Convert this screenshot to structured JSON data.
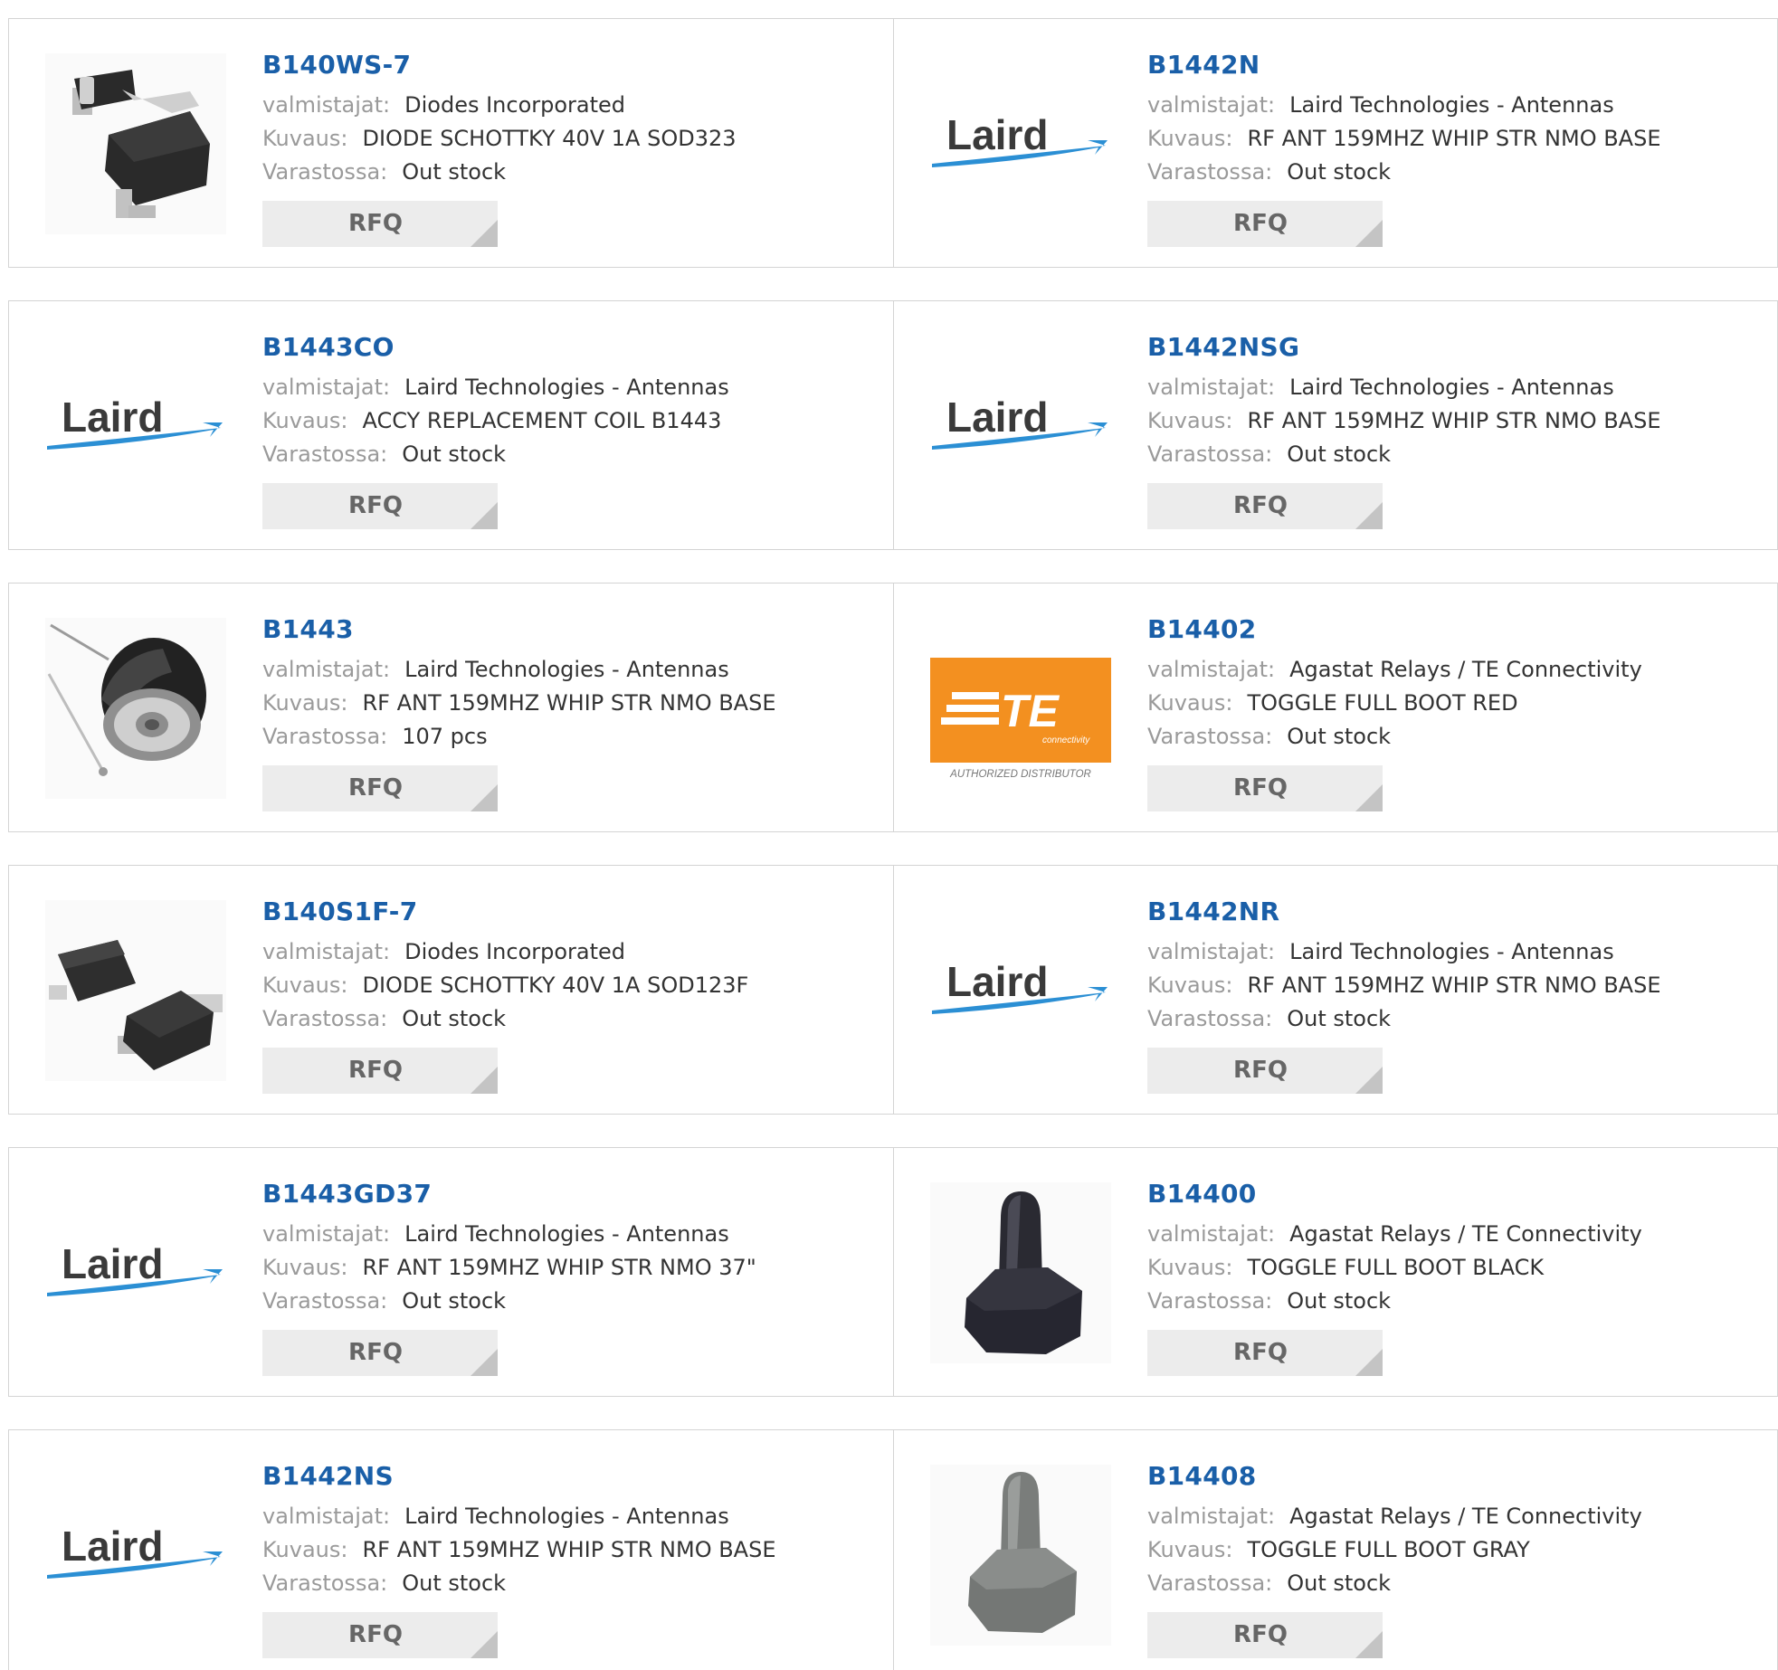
{
  "labels": {
    "manufacturer": "valmistajat:",
    "description": "Kuvaus:",
    "stock": "Varastossa:",
    "rfq": "RFQ"
  },
  "logo": {
    "laird": "Laird",
    "te": "TE",
    "te_sub": "connectivity",
    "te_tagline": "AUTHORIZED DISTRIBUTOR"
  },
  "colors": {
    "part_link": "#1a5fa8",
    "label": "#9a9a9a",
    "border": "#d4d4d4",
    "rfq_bg": "#ececec",
    "te_orange": "#f39020",
    "laird_swoosh": "#2b8fd4"
  },
  "rows": [
    {
      "items": [
        {
          "part": "B140WS-7",
          "manufacturer": "Diodes Incorporated",
          "description": "DIODE SCHOTTKY 40V 1A SOD323",
          "stock": "Out stock",
          "image": "sod323-diode"
        },
        {
          "part": "B1442N",
          "manufacturer": "Laird Technologies - Antennas",
          "description": "RF ANT 159MHZ WHIP STR NMO BASE",
          "stock": "Out stock",
          "image": "laird-logo"
        }
      ]
    },
    {
      "items": [
        {
          "part": "B1443CO",
          "manufacturer": "Laird Technologies - Antennas",
          "description": "ACCY REPLACEMENT COIL B1443",
          "stock": "Out stock",
          "image": "laird-logo"
        },
        {
          "part": "B1442NSG",
          "manufacturer": "Laird Technologies - Antennas",
          "description": "RF ANT 159MHZ WHIP STR NMO BASE",
          "stock": "Out stock",
          "image": "laird-logo"
        }
      ]
    },
    {
      "items": [
        {
          "part": "B1443",
          "manufacturer": "Laird Technologies - Antennas",
          "description": "RF ANT 159MHZ WHIP STR NMO BASE",
          "stock": "107 pcs",
          "image": "antenna-base"
        },
        {
          "part": "B14402",
          "manufacturer": "Agastat Relays / TE Connectivity",
          "description": "TOGGLE FULL BOOT RED",
          "stock": "Out stock",
          "image": "te-logo"
        }
      ]
    },
    {
      "items": [
        {
          "part": "B140S1F-7",
          "manufacturer": "Diodes Incorporated",
          "description": "DIODE SCHOTTKY 40V 1A SOD123F",
          "stock": "Out stock",
          "image": "sod123f-diode"
        },
        {
          "part": "B1442NR",
          "manufacturer": "Laird Technologies - Antennas",
          "description": "RF ANT 159MHZ WHIP STR NMO BASE",
          "stock": "Out stock",
          "image": "laird-logo"
        }
      ]
    },
    {
      "items": [
        {
          "part": "B1443GD37",
          "manufacturer": "Laird Technologies - Antennas",
          "description": "RF ANT 159MHZ WHIP STR NMO 37\"",
          "stock": "Out stock",
          "image": "laird-logo"
        },
        {
          "part": "B14400",
          "manufacturer": "Agastat Relays / TE Connectivity",
          "description": "TOGGLE FULL BOOT BLACK",
          "stock": "Out stock",
          "image": "toggle-boot-black"
        }
      ]
    },
    {
      "items": [
        {
          "part": "B1442NS",
          "manufacturer": "Laird Technologies - Antennas",
          "description": "RF ANT 159MHZ WHIP STR NMO BASE",
          "stock": "Out stock",
          "image": "laird-logo"
        },
        {
          "part": "B14408",
          "manufacturer": "Agastat Relays / TE Connectivity",
          "description": "TOGGLE FULL BOOT GRAY",
          "stock": "Out stock",
          "image": "toggle-boot-gray"
        }
      ]
    }
  ]
}
